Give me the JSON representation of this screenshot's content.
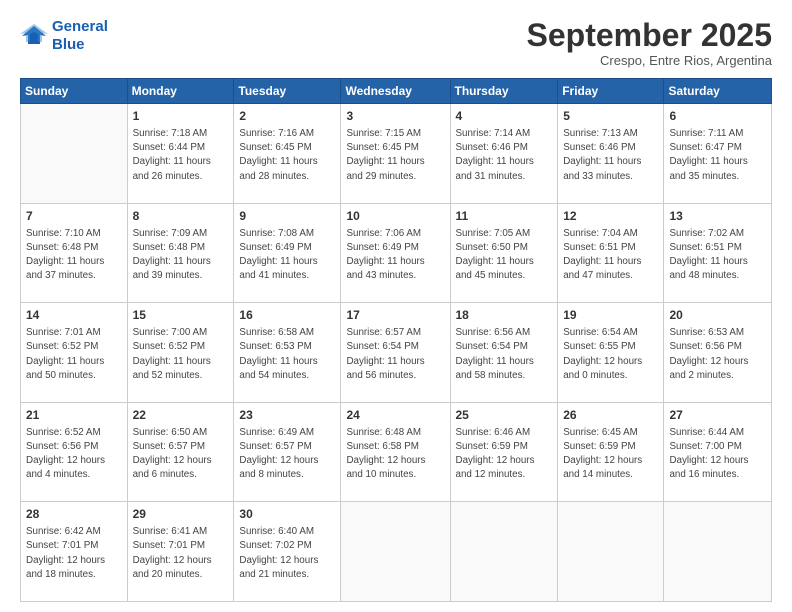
{
  "header": {
    "logo_line1": "General",
    "logo_line2": "Blue",
    "month": "September 2025",
    "location": "Crespo, Entre Rios, Argentina"
  },
  "days_of_week": [
    "Sunday",
    "Monday",
    "Tuesday",
    "Wednesday",
    "Thursday",
    "Friday",
    "Saturday"
  ],
  "weeks": [
    [
      {
        "day": "",
        "info": ""
      },
      {
        "day": "1",
        "info": "Sunrise: 7:18 AM\nSunset: 6:44 PM\nDaylight: 11 hours\nand 26 minutes."
      },
      {
        "day": "2",
        "info": "Sunrise: 7:16 AM\nSunset: 6:45 PM\nDaylight: 11 hours\nand 28 minutes."
      },
      {
        "day": "3",
        "info": "Sunrise: 7:15 AM\nSunset: 6:45 PM\nDaylight: 11 hours\nand 29 minutes."
      },
      {
        "day": "4",
        "info": "Sunrise: 7:14 AM\nSunset: 6:46 PM\nDaylight: 11 hours\nand 31 minutes."
      },
      {
        "day": "5",
        "info": "Sunrise: 7:13 AM\nSunset: 6:46 PM\nDaylight: 11 hours\nand 33 minutes."
      },
      {
        "day": "6",
        "info": "Sunrise: 7:11 AM\nSunset: 6:47 PM\nDaylight: 11 hours\nand 35 minutes."
      }
    ],
    [
      {
        "day": "7",
        "info": "Sunrise: 7:10 AM\nSunset: 6:48 PM\nDaylight: 11 hours\nand 37 minutes."
      },
      {
        "day": "8",
        "info": "Sunrise: 7:09 AM\nSunset: 6:48 PM\nDaylight: 11 hours\nand 39 minutes."
      },
      {
        "day": "9",
        "info": "Sunrise: 7:08 AM\nSunset: 6:49 PM\nDaylight: 11 hours\nand 41 minutes."
      },
      {
        "day": "10",
        "info": "Sunrise: 7:06 AM\nSunset: 6:49 PM\nDaylight: 11 hours\nand 43 minutes."
      },
      {
        "day": "11",
        "info": "Sunrise: 7:05 AM\nSunset: 6:50 PM\nDaylight: 11 hours\nand 45 minutes."
      },
      {
        "day": "12",
        "info": "Sunrise: 7:04 AM\nSunset: 6:51 PM\nDaylight: 11 hours\nand 47 minutes."
      },
      {
        "day": "13",
        "info": "Sunrise: 7:02 AM\nSunset: 6:51 PM\nDaylight: 11 hours\nand 48 minutes."
      }
    ],
    [
      {
        "day": "14",
        "info": "Sunrise: 7:01 AM\nSunset: 6:52 PM\nDaylight: 11 hours\nand 50 minutes."
      },
      {
        "day": "15",
        "info": "Sunrise: 7:00 AM\nSunset: 6:52 PM\nDaylight: 11 hours\nand 52 minutes."
      },
      {
        "day": "16",
        "info": "Sunrise: 6:58 AM\nSunset: 6:53 PM\nDaylight: 11 hours\nand 54 minutes."
      },
      {
        "day": "17",
        "info": "Sunrise: 6:57 AM\nSunset: 6:54 PM\nDaylight: 11 hours\nand 56 minutes."
      },
      {
        "day": "18",
        "info": "Sunrise: 6:56 AM\nSunset: 6:54 PM\nDaylight: 11 hours\nand 58 minutes."
      },
      {
        "day": "19",
        "info": "Sunrise: 6:54 AM\nSunset: 6:55 PM\nDaylight: 12 hours\nand 0 minutes."
      },
      {
        "day": "20",
        "info": "Sunrise: 6:53 AM\nSunset: 6:56 PM\nDaylight: 12 hours\nand 2 minutes."
      }
    ],
    [
      {
        "day": "21",
        "info": "Sunrise: 6:52 AM\nSunset: 6:56 PM\nDaylight: 12 hours\nand 4 minutes."
      },
      {
        "day": "22",
        "info": "Sunrise: 6:50 AM\nSunset: 6:57 PM\nDaylight: 12 hours\nand 6 minutes."
      },
      {
        "day": "23",
        "info": "Sunrise: 6:49 AM\nSunset: 6:57 PM\nDaylight: 12 hours\nand 8 minutes."
      },
      {
        "day": "24",
        "info": "Sunrise: 6:48 AM\nSunset: 6:58 PM\nDaylight: 12 hours\nand 10 minutes."
      },
      {
        "day": "25",
        "info": "Sunrise: 6:46 AM\nSunset: 6:59 PM\nDaylight: 12 hours\nand 12 minutes."
      },
      {
        "day": "26",
        "info": "Sunrise: 6:45 AM\nSunset: 6:59 PM\nDaylight: 12 hours\nand 14 minutes."
      },
      {
        "day": "27",
        "info": "Sunrise: 6:44 AM\nSunset: 7:00 PM\nDaylight: 12 hours\nand 16 minutes."
      }
    ],
    [
      {
        "day": "28",
        "info": "Sunrise: 6:42 AM\nSunset: 7:01 PM\nDaylight: 12 hours\nand 18 minutes."
      },
      {
        "day": "29",
        "info": "Sunrise: 6:41 AM\nSunset: 7:01 PM\nDaylight: 12 hours\nand 20 minutes."
      },
      {
        "day": "30",
        "info": "Sunrise: 6:40 AM\nSunset: 7:02 PM\nDaylight: 12 hours\nand 21 minutes."
      },
      {
        "day": "",
        "info": ""
      },
      {
        "day": "",
        "info": ""
      },
      {
        "day": "",
        "info": ""
      },
      {
        "day": "",
        "info": ""
      }
    ]
  ]
}
